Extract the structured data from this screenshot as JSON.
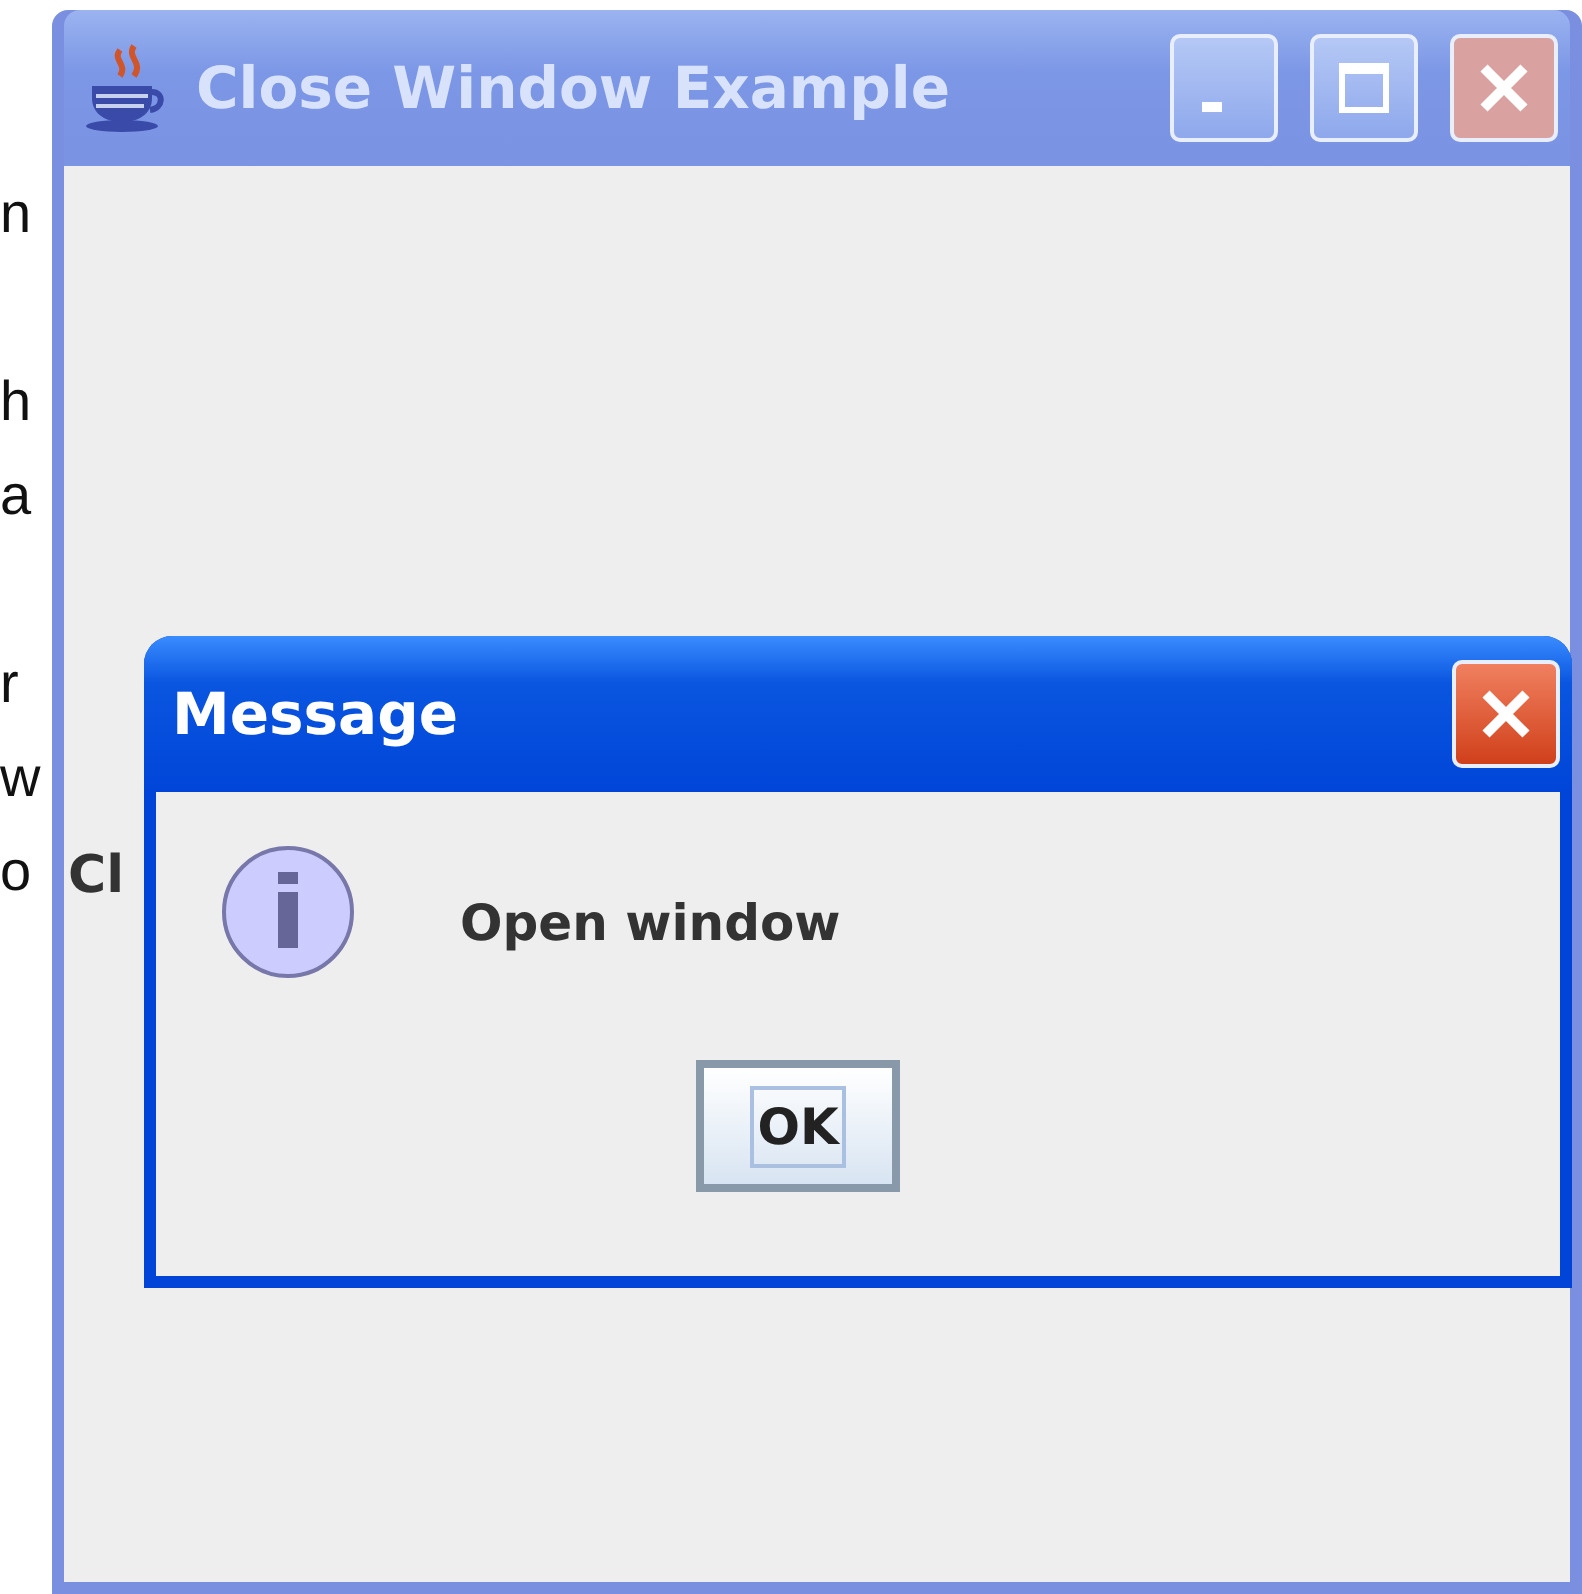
{
  "background_paragraphs": [
    [
      "n"
    ],
    [
      "h",
      "a"
    ],
    [
      "r",
      "w",
      "o"
    ]
  ],
  "window": {
    "title": "Close Window Example",
    "active": false,
    "label": "Cl"
  },
  "dialog": {
    "title": "Message",
    "active": true,
    "message": "Open window",
    "buttons": [
      {
        "label": "OK",
        "focused": true
      }
    ]
  }
}
